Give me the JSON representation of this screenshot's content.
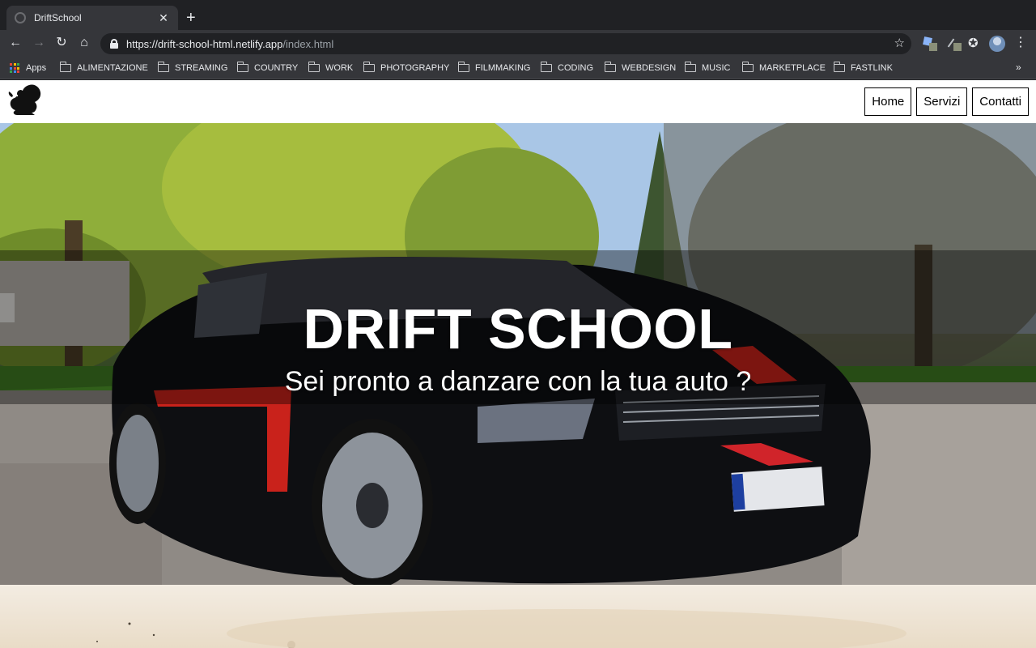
{
  "browser": {
    "tab_title": "DriftSchool",
    "tab_close": "✕",
    "new_tab": "+",
    "url_host": "https://drift-school-html.netlify.app",
    "url_path": "/index.html",
    "bookmarks": [
      {
        "label": "Apps",
        "icon": "apps-grid-icon"
      },
      {
        "label": "ALIMENTAZIONE",
        "icon": "folder-icon"
      },
      {
        "label": "STREAMING",
        "icon": "folder-icon"
      },
      {
        "label": "COUNTRY",
        "icon": "folder-icon"
      },
      {
        "label": "WORK",
        "icon": "folder-icon"
      },
      {
        "label": "PHOTOGRAPHY",
        "icon": "folder-icon"
      },
      {
        "label": "FILMMAKING",
        "icon": "folder-icon"
      },
      {
        "label": "CODING",
        "icon": "folder-icon"
      },
      {
        "label": "WEBDESIGN",
        "icon": "folder-icon"
      },
      {
        "label": "MUSIC",
        "icon": "folder-icon"
      },
      {
        "label": "MARKETPLACE",
        "icon": "folder-icon"
      },
      {
        "label": "FASTLINK",
        "icon": "folder-icon"
      }
    ],
    "bookmarks_more": "»"
  },
  "site": {
    "nav": [
      "Home",
      "Servizi",
      "Contatti"
    ],
    "hero": {
      "title": "DRIFT SCHOOL",
      "subtitle": "Sei pronto a danzare con la tua auto ?"
    }
  },
  "colors": {
    "chrome_dark": "#202124",
    "chrome_toolbar": "#35363a",
    "chrome_text": "#e8eaed",
    "hero_text": "#ffffff",
    "hero_band": "rgba(0,0,0,0.38)"
  }
}
